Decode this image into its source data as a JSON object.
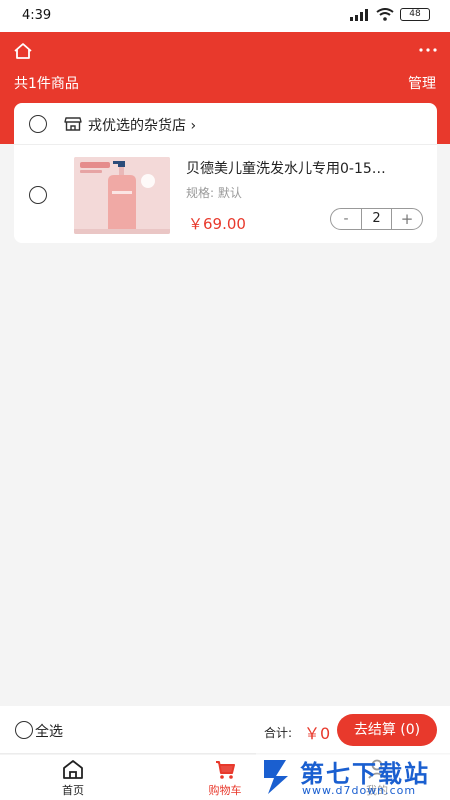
{
  "status_bar": {
    "time": "4:39",
    "battery": "48"
  },
  "header": {
    "item_count": "共1件商品",
    "manage": "管理"
  },
  "store": {
    "name": "戎优选的杂货店",
    "chevron": "›"
  },
  "product": {
    "title": "贝德美儿童洗发水儿专用0-15…",
    "spec": "规格:  默认",
    "price": "￥69.00",
    "minus": "-",
    "quantity": "2",
    "plus": "+"
  },
  "summary": {
    "select_all": "全选",
    "total_label": "合计:",
    "total_value": "￥0",
    "checkout": "去结算 (0)"
  },
  "tabs": [
    {
      "label": "首页",
      "icon": "home-icon"
    },
    {
      "label": "购物车",
      "icon": "cart-icon",
      "active": true
    },
    {
      "label": "我的",
      "icon": "user-icon"
    }
  ],
  "watermark": {
    "title": "第七下载站",
    "url": "www.d7down.com"
  },
  "colors": {
    "accent": "#e8392c",
    "background": "#f4f4f4"
  }
}
